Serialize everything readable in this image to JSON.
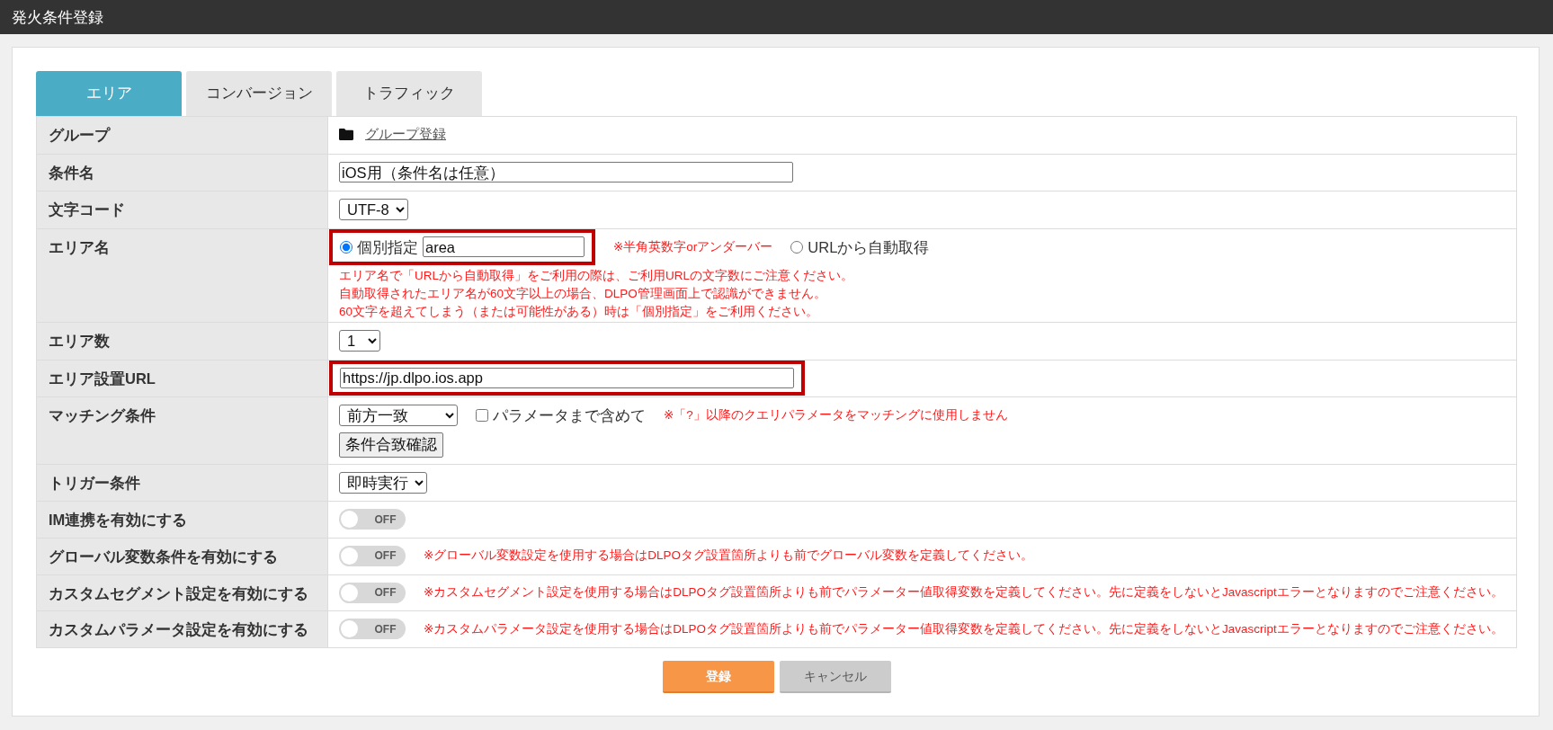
{
  "window": {
    "title": "発火条件登録"
  },
  "tabs": [
    {
      "label": "エリア",
      "selected": true
    },
    {
      "label": "コンバージョン",
      "selected": false
    },
    {
      "label": "トラフィック",
      "selected": false
    }
  ],
  "rows": [
    {
      "kind": "link",
      "label": "グループ",
      "link": "グループ登録",
      "highlighted": false
    },
    {
      "kind": "text",
      "label": "条件名",
      "value": "iOS用（条件名は任意）",
      "highlighted": false
    },
    {
      "kind": "select",
      "label": "文字コード",
      "value": "UTF-8",
      "highlighted": false
    },
    {
      "kind": "radio",
      "label": "エリア名",
      "highlighted": true,
      "options": [
        {
          "label": "個別指定",
          "selected": true,
          "value": "area",
          "note": "※半角英数字orアンダーバー"
        },
        {
          "label": "URLから自動取得",
          "selected": false
        }
      ],
      "notes": [
        "エリア名で「URLから自動取得」をご利用の際は、ご利用URLの文字数にご注意ください。",
        "自動取得されたエリア名が60文字以上の場合、DLPO管理画面上で認識ができません。",
        "60文字を超えてしまう（または可能性がある）時は「個別指定」をご利用ください。"
      ]
    },
    {
      "kind": "select",
      "label": "エリア数",
      "value": "1",
      "highlighted": false
    },
    {
      "kind": "text",
      "label": "エリア設置URL",
      "value": "https://jp.dlpo.ios.app",
      "highlighted": true
    },
    {
      "kind": "matching",
      "label": "マッチング条件",
      "value": "前方一致",
      "highlighted": false,
      "checkbox": {
        "label": "パラメータまで含めて",
        "checked": false
      },
      "note": "※「?」以降のクエリパラメータをマッチングに使用しません",
      "button": "条件合致確認"
    },
    {
      "kind": "select",
      "label": "トリガー条件",
      "value": "即時実行",
      "highlighted": false
    },
    {
      "kind": "toggle",
      "label": "IM連携を有効にする",
      "highlighted": false,
      "toggle": {
        "text": "OFF",
        "on": false
      }
    },
    {
      "kind": "toggle",
      "label": "グローバル変数条件を有効にする",
      "highlighted": false,
      "toggle": {
        "text": "OFF",
        "on": false
      },
      "note": "※グローバル変数設定を使用する場合はDLPOタグ設置箇所よりも前でグローバル変数を定義してください。"
    },
    {
      "kind": "toggle",
      "label": "カスタムセグメント設定を有効にする",
      "highlighted": false,
      "toggle": {
        "text": "OFF",
        "on": false
      },
      "note": "※カスタムセグメント設定を使用する場合はDLPOタグ設置箇所よりも前でパラメーター値取得変数を定義してください。先に定義をしないとJavascriptエラーとなりますのでご注意ください。"
    },
    {
      "kind": "toggle",
      "label": "カスタムパラメータ設定を有効にする",
      "highlighted": false,
      "toggle": {
        "text": "OFF",
        "on": false
      },
      "note": "※カスタムパラメータ設定を使用する場合はDLPOタグ設置箇所よりも前でパラメーター値取得変数を定義してください。先に定義をしないとJavascriptエラーとなりますのでご注意ください。"
    }
  ],
  "buttons": [
    {
      "label": "登録",
      "kind": "primary"
    },
    {
      "label": "キャンセル",
      "kind": "secondary"
    }
  ]
}
